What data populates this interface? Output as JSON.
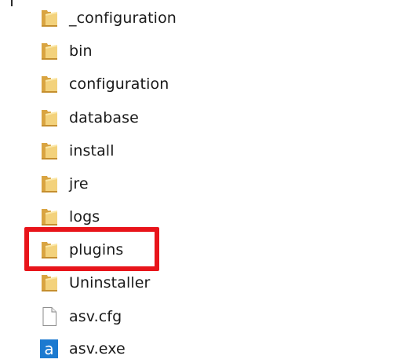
{
  "explorer": {
    "items": [
      {
        "name": "_configuration",
        "type": "folder",
        "icon": "folder-icon"
      },
      {
        "name": "bin",
        "type": "folder",
        "icon": "folder-icon"
      },
      {
        "name": "configuration",
        "type": "folder",
        "icon": "folder-icon"
      },
      {
        "name": "database",
        "type": "folder",
        "icon": "folder-icon"
      },
      {
        "name": "install",
        "type": "folder",
        "icon": "folder-icon"
      },
      {
        "name": "jre",
        "type": "folder",
        "icon": "folder-icon"
      },
      {
        "name": "logs",
        "type": "folder",
        "icon": "folder-icon"
      },
      {
        "name": "plugins",
        "type": "folder",
        "icon": "folder-icon"
      },
      {
        "name": "Uninstaller",
        "type": "folder",
        "icon": "folder-icon"
      },
      {
        "name": "asv.cfg",
        "type": "file",
        "icon": "document-icon"
      },
      {
        "name": "asv.exe",
        "type": "application",
        "icon": "app-icon"
      }
    ],
    "highlighted_item": "plugins",
    "highlight_color": "#e8141a"
  },
  "colors": {
    "folder_back": "#d9a441",
    "folder_front": "#f3d27c",
    "folder_light": "#fbe7a6",
    "document_border": "#8a8a8a",
    "app_blue": "#1c7ad0"
  }
}
